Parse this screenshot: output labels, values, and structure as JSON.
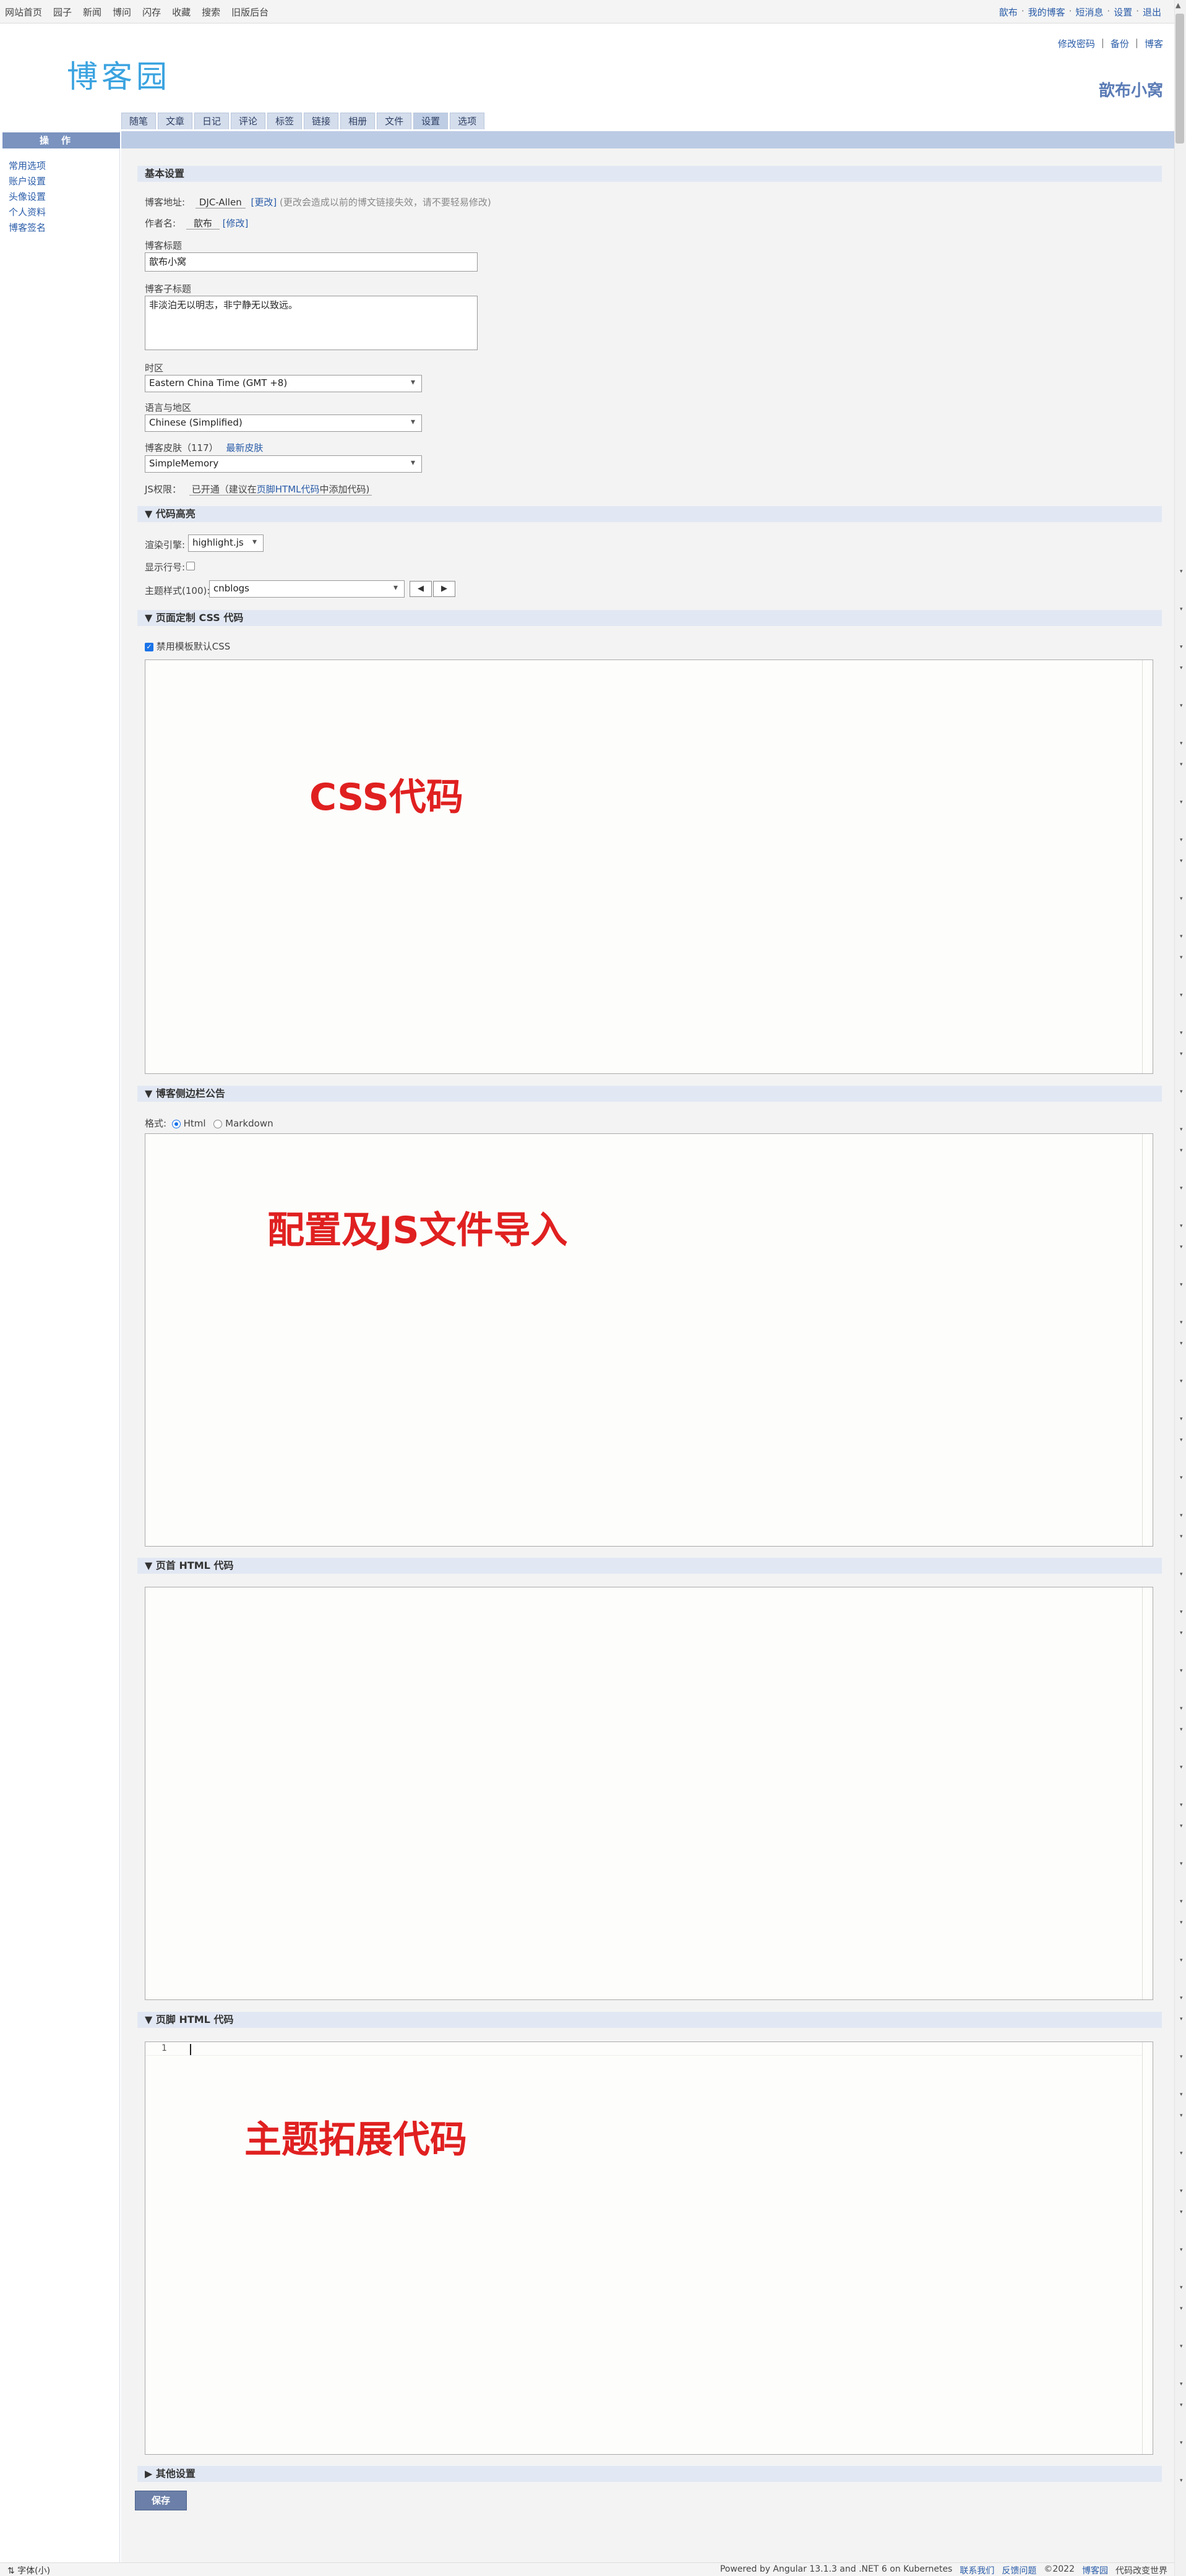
{
  "topnav": {
    "items": [
      "网站首页",
      "园子",
      "新闻",
      "博问",
      "闪存",
      "收藏",
      "搜索",
      "旧版后台"
    ],
    "right": [
      "歆布",
      "我的博客",
      "短消息",
      "设置",
      "退出"
    ]
  },
  "header": {
    "logo": "博客园",
    "links": [
      "修改密码",
      "备份",
      "博客"
    ],
    "blog_name": "歆布小窝"
  },
  "tabs": [
    "随笔",
    "文章",
    "日记",
    "评论",
    "标签",
    "链接",
    "相册",
    "文件",
    "设置",
    "选项"
  ],
  "active_tab": "设置",
  "sidebar": {
    "title": "操作",
    "links": [
      "常用选项",
      "账户设置",
      "头像设置",
      "个人资料",
      "博客签名"
    ]
  },
  "basic": {
    "title": "基本设置",
    "address_label": "博客地址:",
    "address_value": "DJC-Allen",
    "address_change": "[更改]",
    "address_note": "(更改会造成以前的博文链接失效，请不要轻易修改)",
    "author_label": "作者名:",
    "author_value": "歆布",
    "author_edit": "[修改]",
    "title_label": "博客标题",
    "title_value": "歆布小窝",
    "subtitle_label": "博客子标题",
    "subtitle_value": "非淡泊无以明志，非宁静无以致远。",
    "timezone_label": "时区",
    "timezone_value": "Eastern China Time (GMT +8)",
    "language_label": "语言与地区",
    "language_value": "Chinese (Simplified)",
    "skin_label": "博客皮肤（117）",
    "skin_link": "最新皮肤",
    "skin_value": "SimpleMemory",
    "js_label": "JS权限：",
    "js_value_pre": "已开通（建议在",
    "js_value_link": "页脚HTML代码",
    "js_value_post": "中添加代码)"
  },
  "code": {
    "title": "▼ 代码高亮",
    "engine_label": "渲染引擎:",
    "engine_value": "highlight.js",
    "linenum_label": "显示行号:",
    "theme_label": "主题样式(100):",
    "theme_value": "cnblogs",
    "prev": "◀",
    "next": "▶"
  },
  "css": {
    "title": "▼ 页面定制 CSS 代码",
    "disable_label": "禁用模板默认CSS",
    "overlay": "CSS代码"
  },
  "sidebar_notice": {
    "title": "▼ 博客侧边栏公告",
    "format_label": "格式:",
    "opt_html": "Html",
    "opt_md": "Markdown",
    "overlay": "配置及JS文件导入"
  },
  "header_html": {
    "title": "▼ 页首 HTML 代码"
  },
  "footer_html": {
    "title": "▼ 页脚 HTML 代码",
    "line_no": "1",
    "overlay": "主题拓展代码"
  },
  "other": {
    "title": "▶ 其他设置"
  },
  "save_label": "保存",
  "bottombar": {
    "left": "⇅ 字体(小)",
    "right": [
      "Powered by Angular 13.1.3 and .NET 6 on Kubernetes",
      "联系我们",
      "反馈问题",
      "©2022",
      "博客园",
      "代码改变世界"
    ]
  }
}
